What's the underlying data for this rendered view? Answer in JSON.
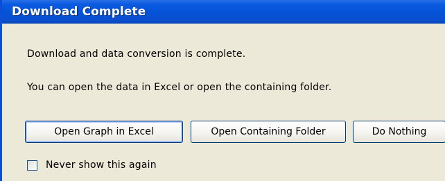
{
  "window": {
    "title": "Download Complete"
  },
  "message": {
    "line1": "Download and data conversion is complete.",
    "line2": "You can open the data in Excel or open the containing folder."
  },
  "buttons": {
    "open_excel": "Open Graph in Excel",
    "open_folder": "Open Containing Folder",
    "do_nothing": "Do Nothing"
  },
  "checkbox": {
    "label": "Never show this again",
    "checked": false
  },
  "colors": {
    "titlebar": "#0553d8",
    "face": "#ece9d8",
    "button_border": "#003c74"
  }
}
